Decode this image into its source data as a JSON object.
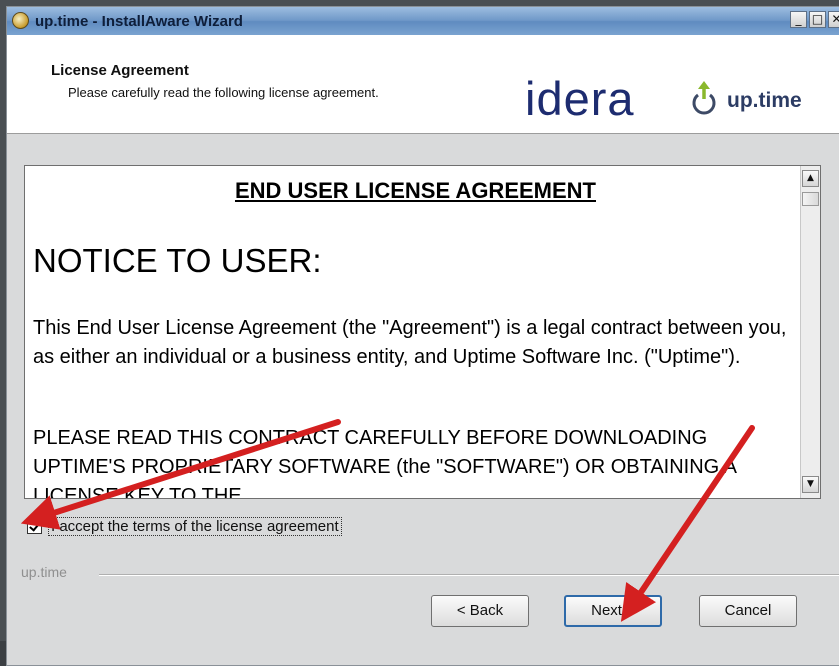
{
  "window": {
    "title": "up.time - InstallAware Wizard",
    "controls": [
      "_",
      "□",
      "✕"
    ]
  },
  "header": {
    "title": "License Agreement",
    "subtitle": "Please carefully read the following license agreement.",
    "logo_brand": "idera",
    "logo_product": "up.time"
  },
  "license": {
    "heading": "END USER LICENSE AGREEMENT",
    "notice": "NOTICE TO USER:",
    "paragraph1": "This End User License Agreement (the \"Agreement\") is a legal contract between you, as either an individual or a business entity, and Uptime Software Inc. (\"Uptime\").",
    "paragraph2": "PLEASE READ THIS CONTRACT CAREFULLY BEFORE DOWNLOADING UPTIME'S  PROPRIETARY SOFTWARE (the \"SOFTWARE\") OR OBTAINING A LICENSE KEY TO THE"
  },
  "accept": {
    "label": "I accept the terms of the license agreement",
    "checked": true
  },
  "group": {
    "label": "up.time"
  },
  "buttons": {
    "back": "< Back",
    "next": "Next >",
    "cancel": "Cancel"
  },
  "colors": {
    "annotation_arrow": "#d42020",
    "titlebar": "#6f98c8",
    "logo": "#1d2c70"
  }
}
